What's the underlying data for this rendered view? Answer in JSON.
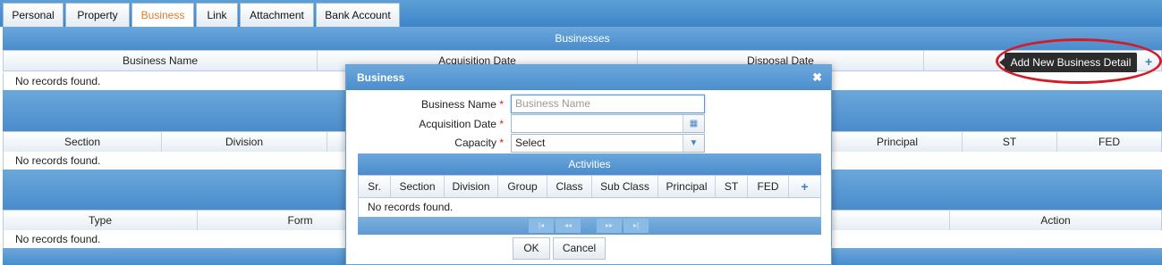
{
  "tabs": [
    "Personal",
    "Property",
    "Business",
    "Link",
    "Attachment",
    "Bank Account"
  ],
  "businesses": {
    "title": "Businesses",
    "columns": [
      "Business Name",
      "Acquisition Date",
      "Disposal Date"
    ],
    "empty": "No records found.",
    "tooltip": "Add New Business Detail",
    "add_icon": "+"
  },
  "section2": {
    "columns": [
      "Section",
      "Division",
      "Principal",
      "ST",
      "FED"
    ],
    "empty": "No records found."
  },
  "section3": {
    "columns": [
      "Type",
      "Form",
      "Action"
    ],
    "empty": "No records found."
  },
  "dialog": {
    "title": "Business",
    "close": "✖",
    "fields": {
      "business_name_label": "Business Name",
      "business_name_placeholder": "Business Name",
      "acquisition_date_label": "Acquisition Date",
      "capacity_label": "Capacity",
      "capacity_value": "Select",
      "required_mark": "*"
    },
    "activities": {
      "title": "Activities",
      "columns": [
        "Sr.",
        "Section",
        "Division",
        "Group",
        "Class",
        "Sub Class",
        "Principal",
        "ST",
        "FED"
      ],
      "add_icon": "+",
      "empty": "No records found."
    },
    "ok": "OK",
    "cancel": "Cancel"
  }
}
